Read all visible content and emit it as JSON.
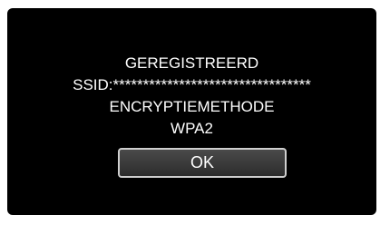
{
  "dialog": {
    "status_title": "GEREGISTREERD",
    "ssid_line": "SSID:*********************************",
    "encryption_label": "ENCRYPTIEMETHODE",
    "encryption_value": "WPA2",
    "ok_label": "OK"
  }
}
